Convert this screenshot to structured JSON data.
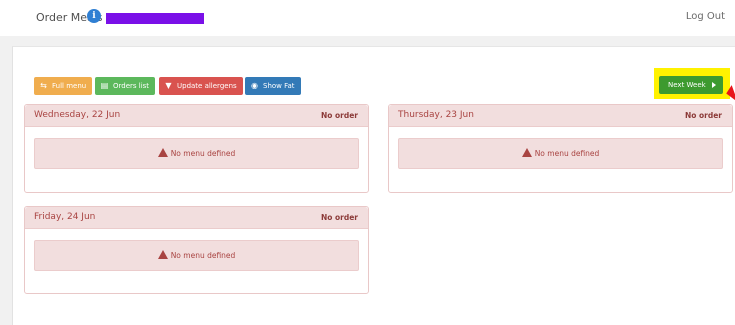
{
  "header": {
    "title": "Order Meals",
    "info_icon": "info-icon",
    "logout_label": "Log Out",
    "redaction_color": "#7a10e8"
  },
  "toolbar": {
    "buttons": [
      {
        "label": "Full menu",
        "icon": "swap-icon",
        "color": "#f0ad4e"
      },
      {
        "label": "Orders list",
        "icon": "list-icon",
        "color": "#5cb85c"
      },
      {
        "label": "Update allergens",
        "icon": "filter-icon",
        "color": "#d9534f"
      },
      {
        "label": "Show Fat",
        "icon": "eye-icon",
        "color": "#337ab7"
      }
    ],
    "next_week": {
      "label": "Next Week",
      "color": "#3d9a2f",
      "highlight_color": "#fff200"
    }
  },
  "days": [
    {
      "date": "Wednesday, 22 Jun",
      "status": "No order",
      "message": "No menu defined"
    },
    {
      "date": "Thursday, 23 Jun",
      "status": "No order",
      "message": "No menu defined"
    },
    {
      "date": "Friday, 24 Jun",
      "status": "No order",
      "message": "No menu defined"
    }
  ],
  "colors": {
    "card_header_bg": "#f2dede",
    "card_text": "#a94442",
    "pointer": "#e8141c"
  }
}
